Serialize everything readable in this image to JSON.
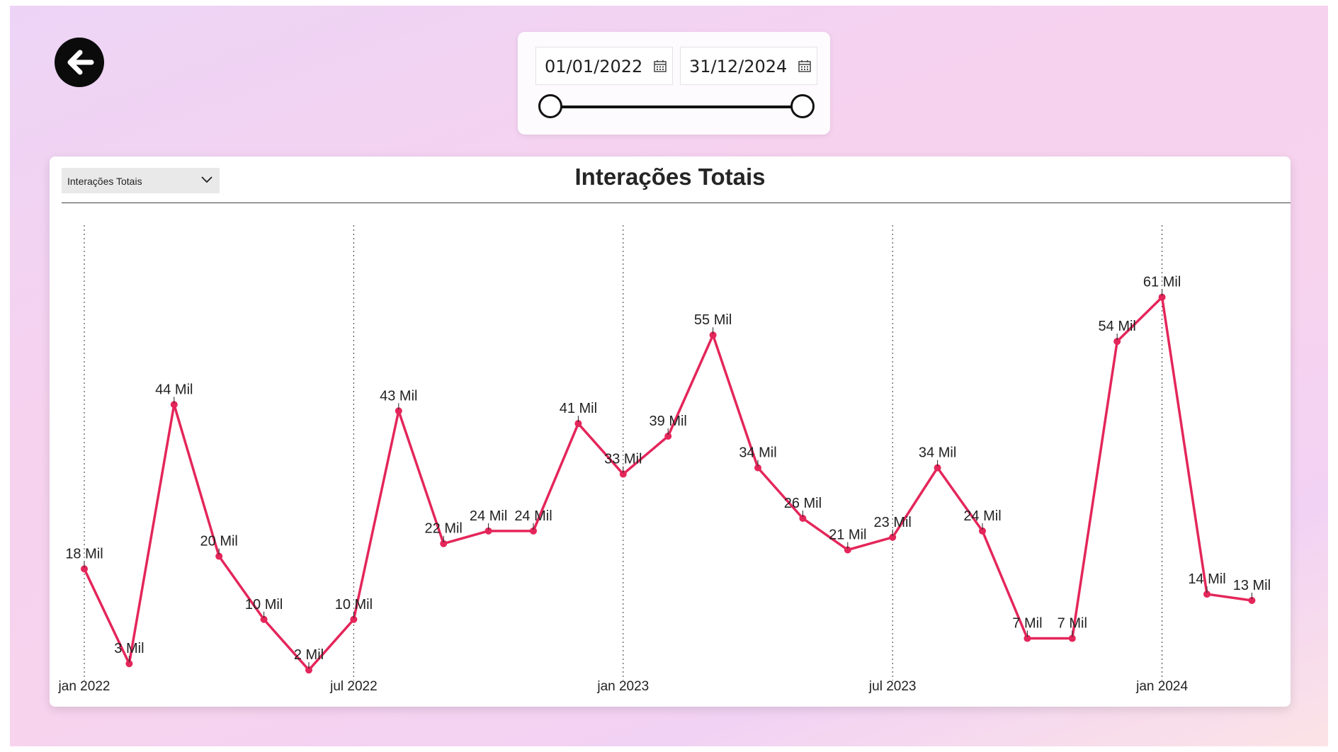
{
  "colors": {
    "line": "#e4265a",
    "marker": "#e4265a",
    "gridline": "#333333"
  },
  "back_button": {
    "icon": "arrow-left-icon"
  },
  "date_range": {
    "start": "01/01/2022",
    "end": "31/12/2024",
    "calendar_icon": "calendar-icon",
    "slider_start_fraction": 0,
    "slider_end_fraction": 1
  },
  "chart_selector": {
    "selected": "Interações Totais"
  },
  "chart_data": {
    "type": "line",
    "title": "Interações Totais",
    "xlabel": "",
    "ylabel": "",
    "x": [
      "2022-01",
      "2022-02",
      "2022-03",
      "2022-04",
      "2022-05",
      "2022-06",
      "2022-07",
      "2022-08",
      "2022-09",
      "2022-10",
      "2022-11",
      "2022-12",
      "2023-01",
      "2023-02",
      "2023-03",
      "2023-04",
      "2023-05",
      "2023-06",
      "2023-07",
      "2023-08",
      "2023-09",
      "2023-10",
      "2023-11",
      "2023-12",
      "2024-01",
      "2024-02",
      "2024-03"
    ],
    "x_tick_labels": [
      {
        "x": "2022-01",
        "label": "jan 2022"
      },
      {
        "x": "2022-07",
        "label": "jul 2022"
      },
      {
        "x": "2023-01",
        "label": "jan 2023"
      },
      {
        "x": "2023-07",
        "label": "jul 2023"
      },
      {
        "x": "2024-01",
        "label": "jan 2024"
      }
    ],
    "values": [
      18,
      3,
      44,
      20,
      10,
      2,
      10,
      43,
      22,
      24,
      24,
      41,
      33,
      39,
      55,
      34,
      26,
      21,
      23,
      34,
      24,
      7,
      7,
      54,
      61,
      14,
      13
    ],
    "data_labels": [
      "18 Mil",
      "3 Mil",
      "44 Mil",
      "20 Mil",
      "10 Mil",
      "2 Mil",
      "10 Mil",
      "43 Mil",
      "22 Mil",
      "24 Mil",
      "24 Mil",
      "41 Mil",
      "33 Mil",
      "39 Mil",
      "55 Mil",
      "34 Mil",
      "26 Mil",
      "21 Mil",
      "23 Mil",
      "34 Mil",
      "24 Mil",
      "7 Mil",
      "7 Mil",
      "54 Mil",
      "61 Mil",
      "14 Mil",
      "13 Mil"
    ],
    "unit": "Mil",
    "ylim": [
      0,
      65
    ],
    "grid": "vertical dotted at tick labels",
    "legend": "none"
  }
}
